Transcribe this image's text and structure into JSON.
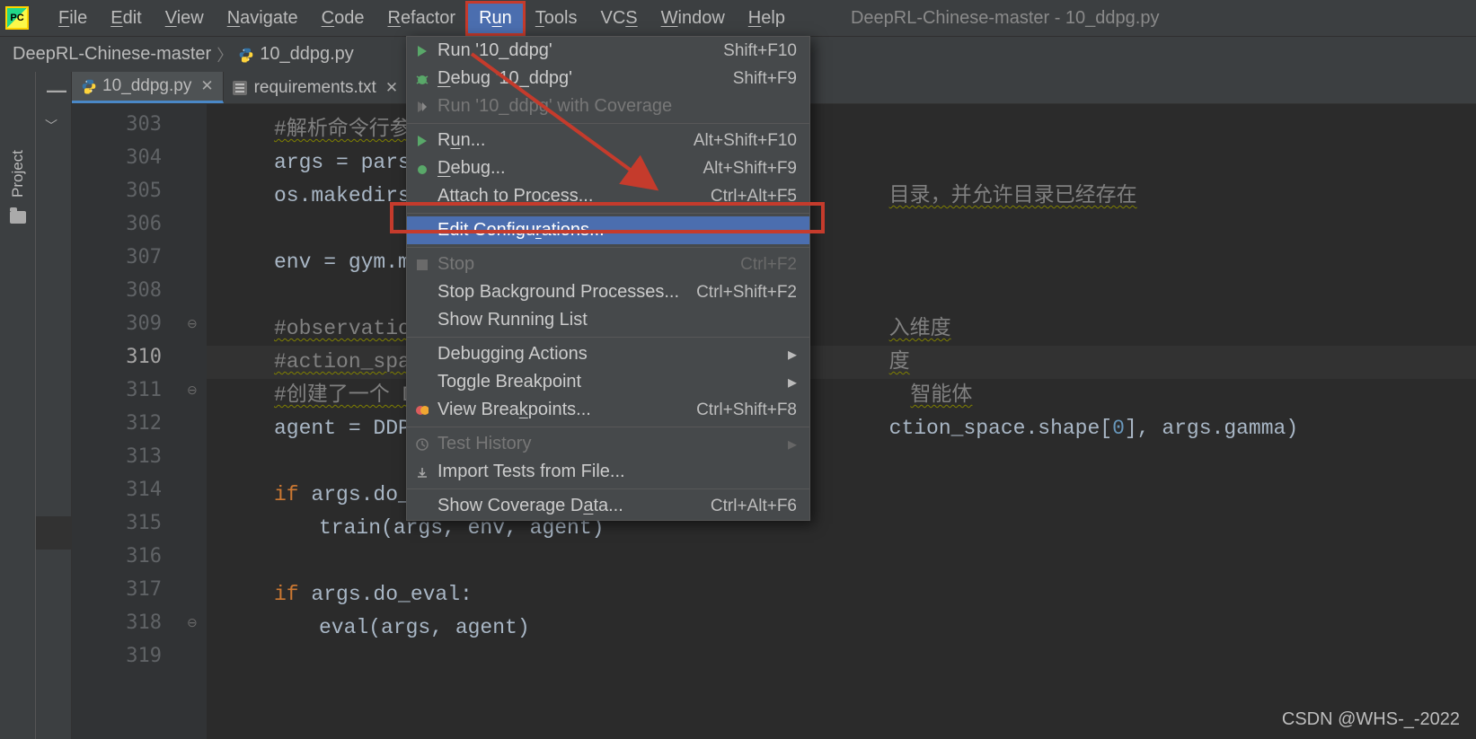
{
  "logo_text": "PC",
  "menubar": {
    "file": "File",
    "edit": "Edit",
    "view": "View",
    "navigate": "Navigate",
    "code": "Code",
    "refactor": "Refactor",
    "run": "Run",
    "tools": "Tools",
    "vcs": "VCS",
    "window": "Window",
    "help": "Help"
  },
  "window_title": "DeepRL-Chinese-master - 10_ddpg.py",
  "breadcrumb": {
    "root": "DeepRL-Chinese-master",
    "file": "10_ddpg.py"
  },
  "sidebar": {
    "project_label": "Project"
  },
  "tabs": {
    "t1": "10_ddpg.py",
    "t2": "requirements.txt"
  },
  "lines": {
    "l303": "303",
    "l304": "304",
    "l305": "305",
    "l306": "306",
    "l307": "307",
    "l308": "308",
    "l309": "309",
    "l310": "310",
    "l311": "311",
    "l312": "312",
    "l313": "313",
    "l314": "314",
    "l315": "315",
    "l316": "316",
    "l317": "317",
    "l318": "318",
    "l319": "319"
  },
  "code": {
    "c303": "#解析命令行参数，转换成",
    "c304": "args = parser.par",
    "c305a": "os.makedirs(args.",
    "c305b": "目录，并允许目录已经存在",
    "c307": "env = gym.make(ar",
    "c309a": "#observation_spac",
    "c309b": "入维度",
    "c310a": "#action_space.sha",
    "c310b": "度",
    "c311a": "#创建了一个 DDPG（De",
    "c311b": "智能体",
    "c312a": "agent = DDPG(env.",
    "c312b": "ction_space.shape[",
    "c312c": "0",
    "c312d": "], args.gamma)",
    "c314a": "if",
    "c314b": " args.do_train:",
    "c315": "train(args, env, agent)",
    "c317a": "if",
    "c317b": " args.do_eval:",
    "c318": "eval(args, agent)"
  },
  "menu": {
    "run_named": "Run '10_ddpg'",
    "run_named_sc": "Shift+F10",
    "debug_named": "Debug '10_ddpg'",
    "debug_named_sc": "Shift+F9",
    "coverage": "Run '10_ddpg' with Coverage",
    "run": "Run...",
    "run_sc": "Alt+Shift+F10",
    "debug": "Debug...",
    "debug_sc": "Alt+Shift+F9",
    "attach": "Attach to Process...",
    "attach_sc": "Ctrl+Alt+F5",
    "editconf": "Edit Configurations...",
    "stop": "Stop",
    "stop_sc": "Ctrl+F2",
    "stopbg": "Stop Background Processes...",
    "stopbg_sc": "Ctrl+Shift+F2",
    "showrun": "Show Running List",
    "dbgactions": "Debugging Actions",
    "togglebp": "Toggle Breakpoint",
    "viewbp": "View Breakpoints...",
    "viewbp_sc": "Ctrl+Shift+F8",
    "testhist": "Test History",
    "importtests": "Import Tests from File...",
    "coveragedata": "Show Coverage Data...",
    "coveragedata_sc": "Ctrl+Alt+F6"
  },
  "watermark": "CSDN @WHS-_-2022"
}
